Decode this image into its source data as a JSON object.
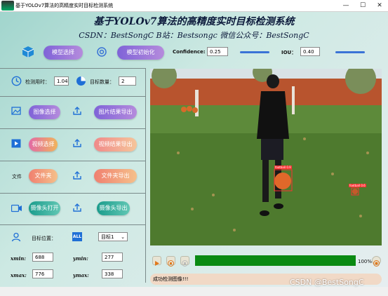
{
  "window": {
    "title": "基于YOLOv7算法的高精度实时目标检测系统",
    "minimize": "—",
    "maximize": "☐",
    "close": "✕"
  },
  "header": {
    "title": "基于YOLOv7算法的高精度实时目标检测系统",
    "subtitle": "CSDN：BestSongC    B站：Bestsongc    微信公众号：BestSongC"
  },
  "toolbar": {
    "model_select": "模型选择",
    "model_init": "模型初始化",
    "confidence_label": "Confidence:",
    "confidence_value": "0.25",
    "iou_label": "IOU：",
    "iou_value": "0.40"
  },
  "stats": {
    "time_label": "检测用时：",
    "time_value": "1.04",
    "count_label": "目标数量：",
    "count_value": "2"
  },
  "image": {
    "select": "图像选择",
    "export": "图片结果导出"
  },
  "video": {
    "select": "视频选择",
    "export": "视频结果导出"
  },
  "folder": {
    "label": "文件",
    "select": "文件夹",
    "export": "文件夹导出"
  },
  "camera": {
    "open": "摄像头打开",
    "export": "摄像头导出"
  },
  "position": {
    "label": "目标位置：",
    "all": "ALL",
    "target_select": "目标1",
    "xmin_label": "xmin:",
    "xmin": "688",
    "ymin_label": "ymin:",
    "ymin": "277",
    "xmax_label": "xmax:",
    "xmax": "776",
    "ymax_label": "ymax:",
    "ymax": "338"
  },
  "detections": [
    {
      "label": "football 0.9"
    },
    {
      "label": "football 0.6"
    }
  ],
  "player": {
    "progress": 100,
    "progress_text": "100%"
  },
  "status": {
    "text": "成功检测图像!!!"
  },
  "watermark": "CSDN @BestSongC",
  "colors": {
    "accent": "#3a73d6",
    "progress": "#0a8a12",
    "heading": "#0d1b3c"
  }
}
